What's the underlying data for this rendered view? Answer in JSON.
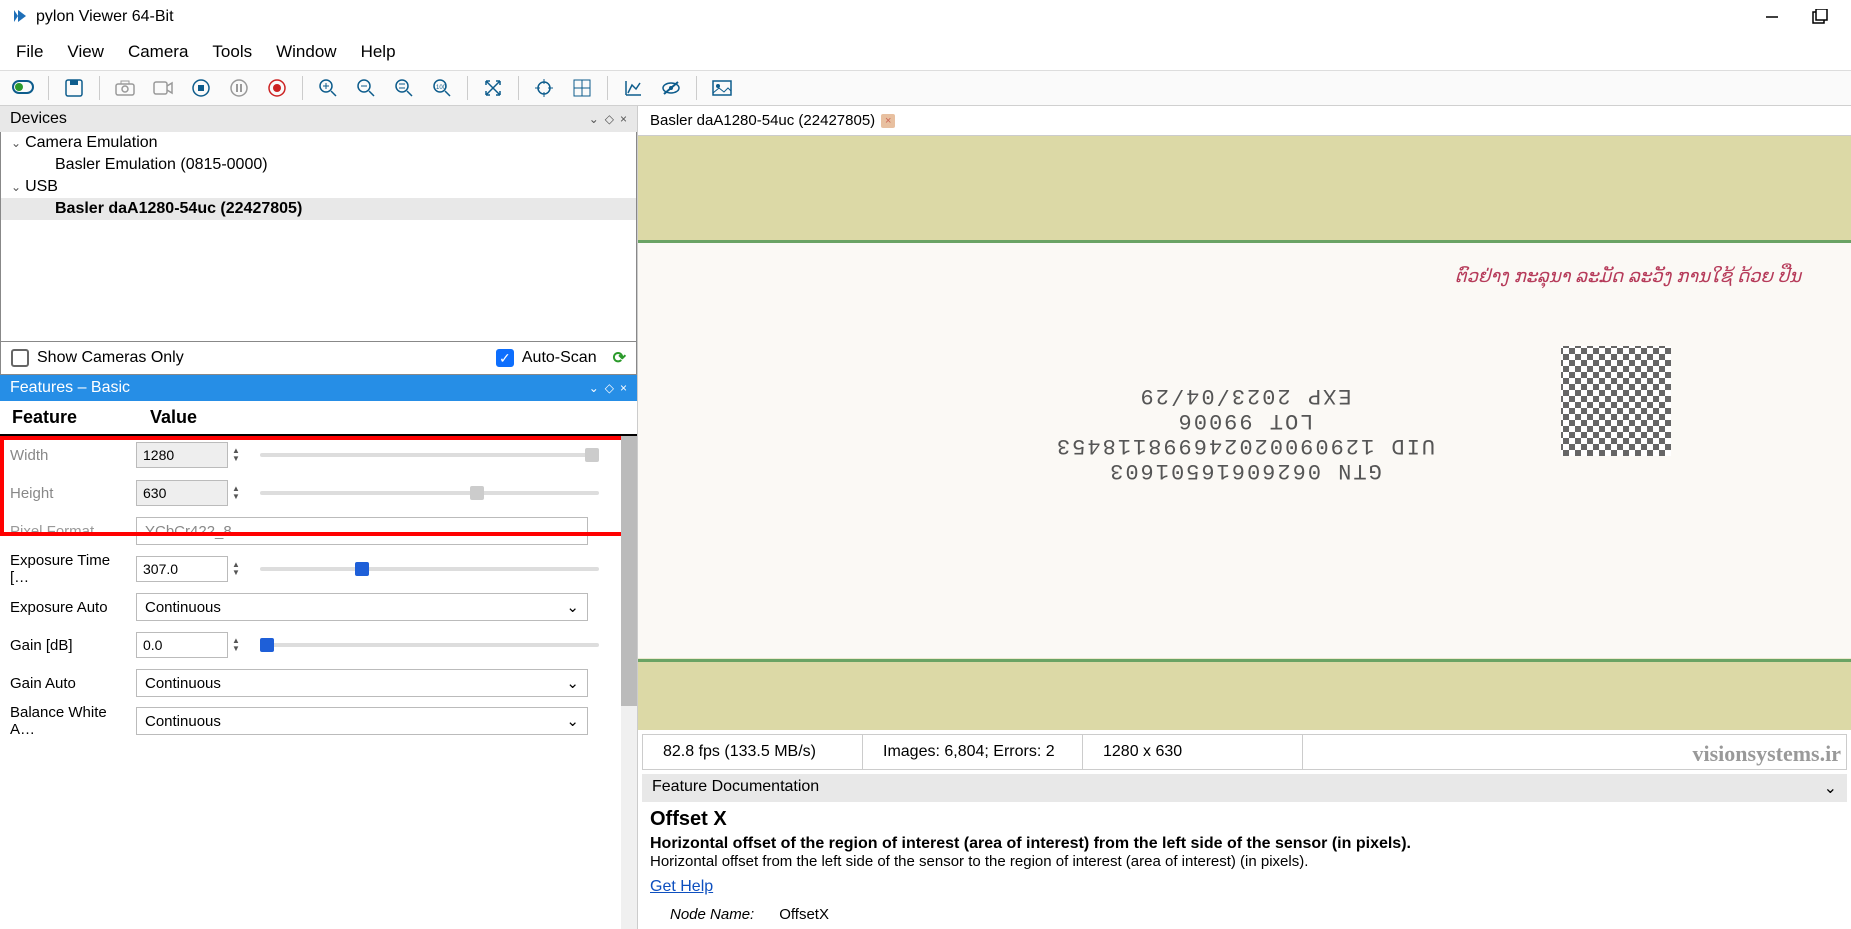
{
  "window": {
    "title": "pylon Viewer 64-Bit"
  },
  "menu": {
    "file": "File",
    "edit": "View",
    "camera": "Camera",
    "tools": "Tools",
    "window": "Window",
    "help": "Help"
  },
  "panels": {
    "devices": "Devices",
    "features": "Features – Basic",
    "doc": "Feature Documentation"
  },
  "devices": {
    "group1": "Camera Emulation",
    "item1": "Basler Emulation (0815-0000)",
    "group2": "USB",
    "item2": "Basler daA1280-54uc (22427805)",
    "show_only": "Show Cameras Only",
    "auto_scan": "Auto-Scan"
  },
  "featcols": {
    "c1": "Feature",
    "c2": "Value"
  },
  "features": {
    "width": {
      "label": "Width",
      "value": "1280"
    },
    "height": {
      "label": "Height",
      "value": "630"
    },
    "pixfmt": {
      "label": "Pixel Format",
      "value": "YCbCr422_8"
    },
    "exptime": {
      "label": "Exposure Time […",
      "value": "307.0"
    },
    "expauto": {
      "label": "Exposure Auto",
      "value": "Continuous"
    },
    "gain": {
      "label": "Gain [dB]",
      "value": "0.0"
    },
    "gainauto": {
      "label": "Gain Auto",
      "value": "Continuous"
    },
    "balance": {
      "label": "Balance White A…",
      "value": "Continuous"
    }
  },
  "image": {
    "tab": "Basler daA1280-54uc (22427805)",
    "red_text": "ຕົວຢ່າງ ກະລຸນາ ລະມັດ ລະວັງ ການໃຊ້ ດ້ວຍ ປືນ",
    "prod1": "GTN 06260616501603",
    "prod2": "UID 129090020246998118453",
    "prod3": "LOT 99006",
    "prod4": "EXP 2023/04/29"
  },
  "status": {
    "fps": "82.8 fps (133.5 MB/s)",
    "images": "Images: 6,804; Errors: 2",
    "res": "1280 x 630"
  },
  "doc": {
    "title": "Offset X",
    "sub": "Horizontal offset of the region of interest (area of interest) from the left side of the sensor (in pixels).",
    "desc": "Horizontal offset from the left side of the sensor to the region of interest (area of interest) (in pixels).",
    "link": "Get Help",
    "node_label": "Node Name:",
    "node_value": "OffsetX"
  },
  "watermark": "visionsystems.ir"
}
